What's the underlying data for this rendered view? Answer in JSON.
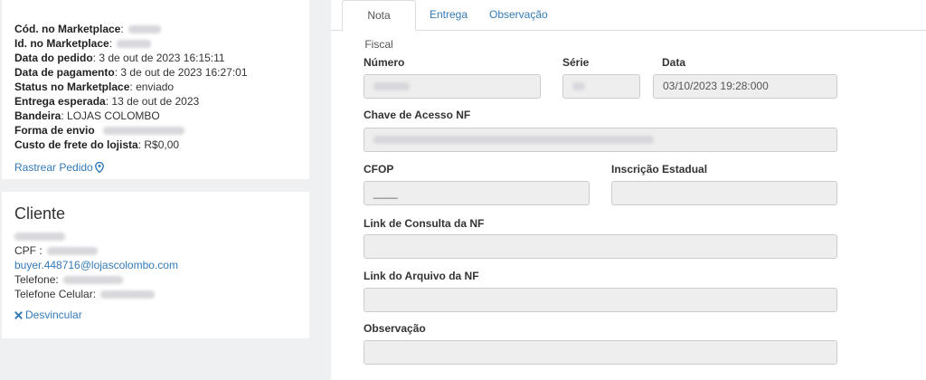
{
  "order": {
    "lines": [
      {
        "label": "Cód. no Marketplace",
        "sep": ":",
        "value": ""
      },
      {
        "label": "Id. no Marketplace",
        "sep": ":",
        "value": ""
      },
      {
        "label": "Data do pedido",
        "sep": ":",
        "value": "3 de out de 2023 16:15:11"
      },
      {
        "label": "Data de pagamento",
        "sep": ":",
        "value": "3 de out de 2023 16:27:01"
      },
      {
        "label": "Status no Marketplace",
        "sep": ":",
        "value": "enviado"
      },
      {
        "label": "Entrega esperada",
        "sep": ":",
        "value": "13 de out de 2023"
      },
      {
        "label": "Bandeira",
        "sep": ":",
        "value": "LOJAS COLOMBO"
      },
      {
        "label": "Forma de envio",
        "sep": "",
        "value": ""
      },
      {
        "label": "Custo de frete do lojista",
        "sep": ":",
        "value": "R$0,00"
      }
    ],
    "track_label": "Rastrear Pedido"
  },
  "client": {
    "title": "Cliente",
    "cpf_label": "CPF :",
    "email": "buyer.448716@lojascolombo.com",
    "phone_label": "Telefone:",
    "mobile_label": "Telefone Celular:",
    "unlink_label": "Desvincular"
  },
  "tabs": {
    "nota_fiscal": "Nota Fiscal",
    "entrega": "Entrega",
    "observacao": "Observação"
  },
  "form": {
    "numero_label": "Número",
    "serie_label": "Série",
    "data_label": "Data",
    "data_value": "03/10/2023 19:28:000",
    "chave_label": "Chave de Acesso NF",
    "cfop_label": "CFOP",
    "cfop_value": "____",
    "ie_label": "Inscrição Estadual",
    "link_consulta_label": "Link de Consulta da NF",
    "link_arquivo_label": "Link do Arquivo da NF",
    "observacao_label": "Observação"
  },
  "colors": {
    "link": "#337ab7",
    "field_bg": "#eeeeee",
    "page_bg": "#eef0f2"
  },
  "icons": {
    "track": "map-pin-icon",
    "unlink": "x-icon"
  }
}
